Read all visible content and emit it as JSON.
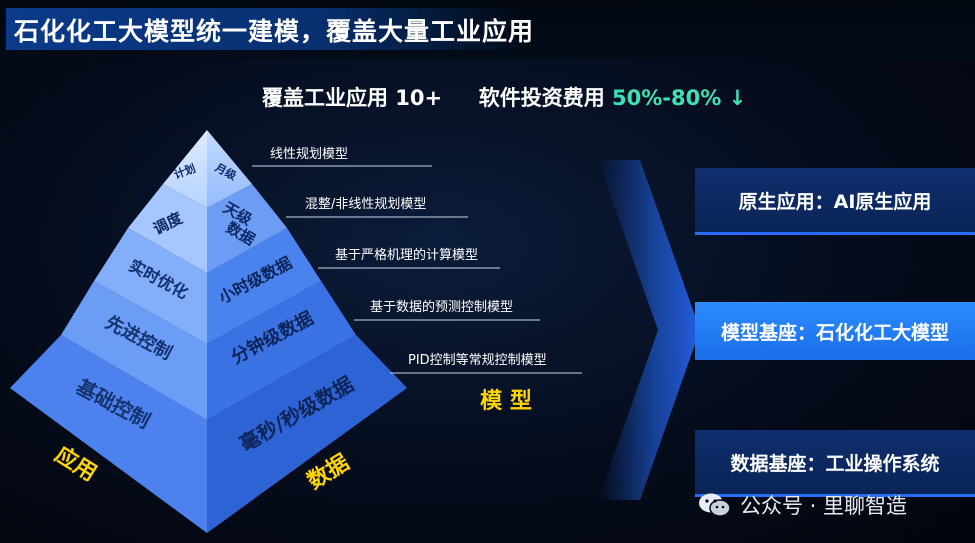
{
  "title": "石化化工大模型统一建模，覆盖大量工业应用",
  "subtitle": {
    "part1": "覆盖工业应用 10+",
    "part2": "软件投资费用",
    "highlight": "50%-80%",
    "arrow": "↓"
  },
  "pyramid": {
    "levels": [
      {
        "left": "计划",
        "right": "月级",
        "model": "线性规划模型"
      },
      {
        "left": "调度",
        "right_lines": [
          "天级",
          "数据"
        ],
        "model": "混整/非线性规划模型"
      },
      {
        "left": "实时优化",
        "right": "小时级数据",
        "model": "基于严格机理的计算模型"
      },
      {
        "left": "先进控制",
        "right": "分钟级数据",
        "model": "基于数据的预测控制模型"
      },
      {
        "left": "基础控制",
        "right": "毫秒/秒级数据",
        "model": "PID控制等常规控制模型"
      }
    ],
    "face_labels": {
      "left": "应用",
      "right": "数据",
      "models": "模 型"
    }
  },
  "panels": [
    {
      "text": "原生应用：AI原生应用"
    },
    {
      "text": "模型基座：石化化工大模型"
    },
    {
      "text": "数据基座：工业操作系统"
    }
  ],
  "watermark": {
    "text": "公众号 · 里聊智造",
    "icon": "wechat-icon"
  },
  "colors": {
    "accent_green": "#3ee0b7",
    "label_yellow": "#ffd400",
    "panel_blue": "#2d8cff"
  }
}
